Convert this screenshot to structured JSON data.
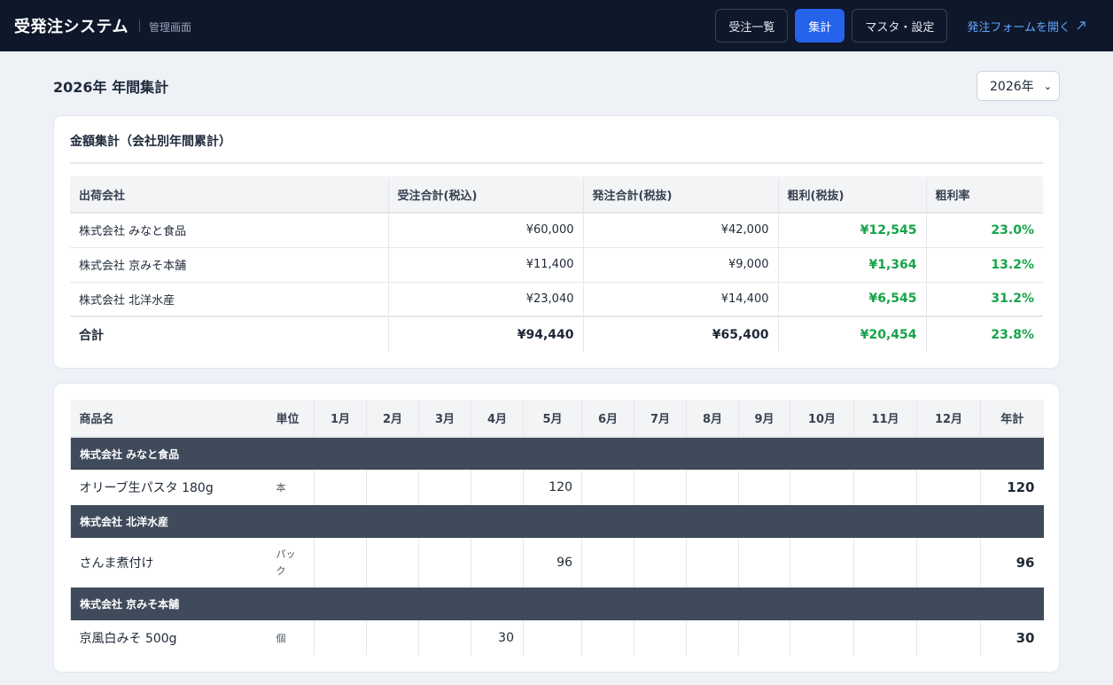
{
  "app": {
    "title": "受発注システム",
    "subtitle": "管理画面"
  },
  "nav": {
    "orders": "受注一覧",
    "summary": "集計",
    "master": "マスタ・設定",
    "form_link": "発注フォームを開く",
    "form_link_icon": "external-link-icon"
  },
  "page": {
    "title": "2026年 年間集計",
    "year_selected": "2026年"
  },
  "amount_summary": {
    "title": "金額集計（会社別年間累計）",
    "headers": [
      "出荷会社",
      "受注合計(税込)",
      "発注合計(税抜)",
      "粗利(税抜)",
      "粗利率"
    ],
    "rows": [
      [
        "株式会社 みなと食品",
        "¥60,000",
        "¥42,000",
        "¥12,545",
        "23.0%"
      ],
      [
        "株式会社 京みそ本舗",
        "¥11,400",
        "¥9,000",
        "¥1,364",
        "13.2%"
      ],
      [
        "株式会社 北洋水産",
        "¥23,040",
        "¥14,400",
        "¥6,545",
        "31.2%"
      ]
    ],
    "total": [
      "合計",
      "¥94,440",
      "¥65,400",
      "¥20,454",
      "23.8%"
    ],
    "profit_color": "#16a34a"
  },
  "monthly": {
    "headers": {
      "name": "商品名",
      "unit": "単位",
      "months": [
        "1月",
        "2月",
        "3月",
        "4月",
        "5月",
        "6月",
        "7月",
        "8月",
        "9月",
        "10月",
        "11月",
        "12月"
      ],
      "total": "年計"
    },
    "groups": [
      {
        "company": "株式会社 みなと食品",
        "item": {
          "name": "オリーブ生パスタ 180g",
          "unit": "本",
          "months": [
            "",
            "",
            "",
            "",
            "120",
            "",
            "",
            "",
            "",
            "",
            "",
            ""
          ],
          "total": "120"
        }
      },
      {
        "company": "株式会社 北洋水産",
        "item": {
          "name": "さんま煮付け",
          "unit": "パック",
          "months": [
            "",
            "",
            "",
            "",
            "96",
            "",
            "",
            "",
            "",
            "",
            "",
            ""
          ],
          "total": "96"
        }
      },
      {
        "company": "株式会社 京みそ本舗",
        "item": {
          "name": "京風白みそ 500g",
          "unit": "個",
          "months": [
            "",
            "",
            "",
            "30",
            "",
            "",
            "",
            "",
            "",
            "",
            "",
            ""
          ],
          "total": "30"
        }
      }
    ],
    "group_row_color": "#3f4a5b"
  }
}
